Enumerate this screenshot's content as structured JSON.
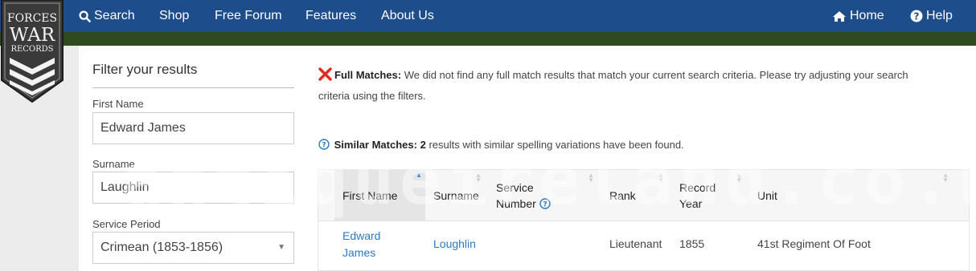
{
  "brand": {
    "line1": "FORCES",
    "line2": "WAR",
    "line3": "RECORDS"
  },
  "nav": {
    "search": "Search",
    "shop": "Shop",
    "forum": "Free Forum",
    "features": "Features",
    "about": "About Us",
    "home": "Home",
    "help": "Help"
  },
  "filters": {
    "title": "Filter your results",
    "first_name_label": "First Name",
    "first_name_value": "Edward James",
    "surname_label": "Surname",
    "surname_value": "Laughlin",
    "service_period_label": "Service Period",
    "service_period_value": "Crimean (1853-1856)"
  },
  "messages": {
    "full_title": "Full Matches:",
    "full_text_1": "We did not find any full match results that match your current search criteria. Please try adjusting your search",
    "full_text_2": "criteria using the filters.",
    "similar_title": "Similar Matches:",
    "similar_count": "2",
    "similar_text": "results with similar spelling variations have been found."
  },
  "table": {
    "headers": {
      "first_name": "First Name",
      "surname": "Surname",
      "service_number_1": "Service",
      "service_number_2": "Number",
      "rank": "Rank",
      "record_year_1": "Record",
      "record_year_2": "Year",
      "unit": "Unit"
    },
    "rows": [
      {
        "first_name_1": "Edward",
        "first_name_2": "James",
        "surname": "Loughlin",
        "service_number": "",
        "rank": "Lieutenant",
        "record_year": "1855",
        "unit": "41st Regiment Of Foot"
      }
    ]
  },
  "watermark": "antiqueireland.co.uk",
  "colors": {
    "nav": "#1e4d8c",
    "green_bar": "#2f4a1f",
    "link": "#2a7bc4",
    "error": "#e02a1a"
  }
}
